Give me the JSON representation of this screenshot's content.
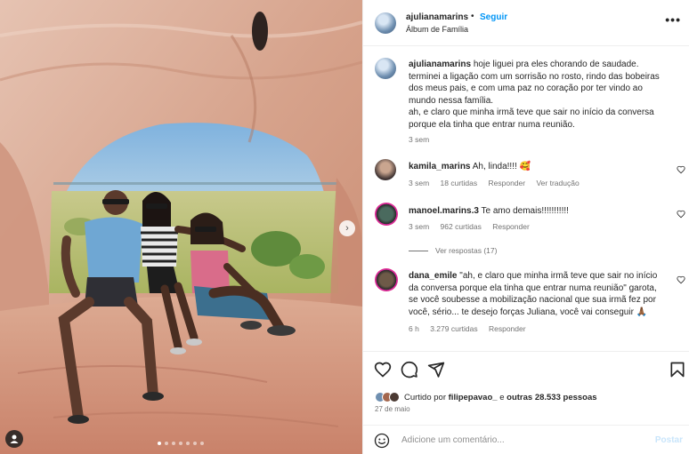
{
  "post": {
    "username": "ajulianamarins",
    "separator": "•",
    "follow_label": "Seguir",
    "subtitle": "Álbum de Família",
    "more_icon": "more-options-icon"
  },
  "caption": {
    "username": "ajulianamarins",
    "lines": [
      "hoje liguei pra eles chorando de saudade.",
      "terminei a ligação com um sorrisão no rosto, rindo das bobeiras",
      "dos meus pais, e com uma paz no coração por ter vindo ao",
      "mundo nessa família.",
      "ah, e claro que minha irmã teve que sair no início da conversa",
      "porque ela tinha que entrar numa reunião."
    ],
    "time": "3 sem"
  },
  "comments": [
    {
      "username": "kamila_marins",
      "text": "Ah, linda!!!! 🥰",
      "time": "3 sem",
      "likes": "18 curtidas",
      "reply": "Responder",
      "extra": "Ver tradução"
    },
    {
      "username": "manoel.marins.3",
      "text": "Te amo demais!!!!!!!!!!!",
      "time": "3 sem",
      "likes": "962 curtidas",
      "reply": "Responder",
      "view_replies": "Ver respostas (17)"
    },
    {
      "username": "dana_emile",
      "lines": [
        "\"ah, e claro que minha irmã teve que sair no início",
        "da conversa porque ela tinha que entrar numa reunião\" garota,",
        "se você soubesse a mobilização nacional que sua irmã fez por",
        "você, sério... te desejo forças Juliana, você vai conseguir 🙏🏾"
      ],
      "time": "6 h",
      "likes": "3.279 curtidas",
      "reply": "Responder"
    }
  ],
  "actions": {
    "likes_prefix": "Curtido por",
    "liked_by": "filipepavao_",
    "likes_middle": "e",
    "likes_others": "outras 28.533 pessoas",
    "date": "27 de maio",
    "add_comment_placeholder": "Adicione um comentário...",
    "publish_label": "Postar"
  },
  "media": {
    "carousel_count": 7,
    "active_index": 0
  },
  "colors": {
    "link_blue": "#0095f6",
    "muted_text": "#737373",
    "border": "#efefef"
  }
}
